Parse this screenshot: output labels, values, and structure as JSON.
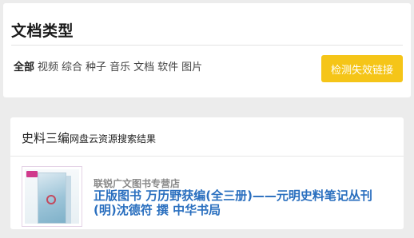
{
  "filter": {
    "heading": "文档类型",
    "types": [
      "全部",
      "视频",
      "综合",
      "种子",
      "音乐",
      "文档",
      "软件",
      "图片"
    ],
    "active_type": "全部",
    "check_button_label": "检测失效链接",
    "check_button_color": "#f5c518"
  },
  "results": {
    "keyword": "史料三编",
    "suffix": "网盘云资源搜索结果",
    "items": [
      {
        "shop": "联锐广文图书专营店",
        "title": "正版图书 万历野获编(全三册)——元明史料笔记丛刊(明)沈德符 撰 中华书局",
        "thumbnail_icon": "book-cover-image",
        "title_color": "#2a6fbf"
      }
    ]
  }
}
